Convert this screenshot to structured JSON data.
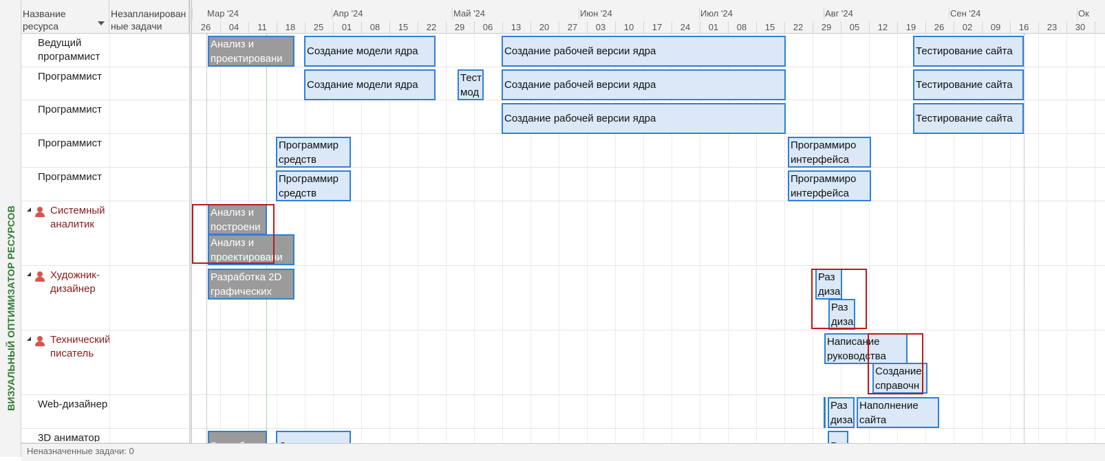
{
  "side_label": "ВИЗУАЛЬНЫЙ ОПТИМИЗАТОР РЕСУРСОВ",
  "header": {
    "resource_name": "Название ресурса",
    "unplanned": "Незапланированные задачи"
  },
  "timescale": {
    "months": [
      "Мар '24",
      "Апр '24",
      "Май '24",
      "Июн '24",
      "Июл '24",
      "Авг '24",
      "Сен '24",
      "Ок"
    ],
    "days": [
      "26",
      "04",
      "11",
      "18",
      "25",
      "01",
      "08",
      "15",
      "22",
      "29",
      "06",
      "13",
      "20",
      "27",
      "03",
      "10",
      "17",
      "24",
      "01",
      "08",
      "15",
      "22",
      "29",
      "05",
      "12",
      "19",
      "26",
      "02",
      "09",
      "16",
      "23",
      "30"
    ]
  },
  "resources": [
    {
      "name": "Ведущий программист",
      "group": false
    },
    {
      "name": "Программист",
      "group": false
    },
    {
      "name": "Программист",
      "group": false
    },
    {
      "name": "Программист",
      "group": false
    },
    {
      "name": "Программист",
      "group": false
    },
    {
      "name": "Системный аналитик",
      "group": true
    },
    {
      "name": "Художник-дизайнер",
      "group": true
    },
    {
      "name": "Технический писатель",
      "group": true
    },
    {
      "name": "Web-дизайнер",
      "group": false
    },
    {
      "name": "3D аниматор",
      "group": false
    }
  ],
  "tasks": {
    "t1": {
      "l1": "Анализ и",
      "l2": "проектировани"
    },
    "t2": {
      "l1": "Создание модели ядра",
      "l2": ""
    },
    "t3": {
      "l1": "Создание рабочей версии ядра",
      "l2": ""
    },
    "t4": {
      "l1": "Тестирование сайта",
      "l2": ""
    },
    "t5": {
      "l1": "Создание модели ядра",
      "l2": ""
    },
    "t6": {
      "l1": "Тест",
      "l2": "мод"
    },
    "t7": {
      "l1": "Создание рабочей версии ядра",
      "l2": ""
    },
    "t8": {
      "l1": "Тестирование сайта",
      "l2": ""
    },
    "t9": {
      "l1": "Создание рабочей версии ядра",
      "l2": ""
    },
    "t10": {
      "l1": "Тестирование сайта",
      "l2": ""
    },
    "t11": {
      "l1": "Программир",
      "l2": "средств"
    },
    "t12": {
      "l1": "Программиро",
      "l2": "интерфейса"
    },
    "t13": {
      "l1": "Программир",
      "l2": "средств"
    },
    "t14": {
      "l1": "Программиро",
      "l2": "интерфейса"
    },
    "t15": {
      "l1": "Анализ и",
      "l2": "построени"
    },
    "t16": {
      "l1": "Анализ и",
      "l2": "проектировани"
    },
    "t17": {
      "l1": "Разработка 2D",
      "l2": "графических"
    },
    "t18": {
      "l1": "Раз",
      "l2": "диза"
    },
    "t19": {
      "l1": "Раз",
      "l2": "диза"
    },
    "t20": {
      "l1": "Написание",
      "l2": "руководства"
    },
    "t21": {
      "l1": "Создание",
      "l2": "справочн"
    },
    "t22": {
      "l1": "Раз",
      "l2": "диза"
    },
    "t23": {
      "l1": "Наполнение",
      "l2": "сайта"
    },
    "t24": {
      "l1": "Разработк",
      "l2": ""
    },
    "t25": {
      "l1": "Создание",
      "l2": ""
    },
    "t26": {
      "l1": "Раз",
      "l2": ""
    }
  },
  "footer": {
    "text": "Неназначенные задачи: 0"
  },
  "colors": {
    "accent": "#2f7fd8",
    "bar_fill": "#dae8f7",
    "done_fill": "#9b9b9b",
    "overalloc": "#b71c1c",
    "group_text": "#8b1a1a",
    "side_label": "#2e7d32"
  }
}
